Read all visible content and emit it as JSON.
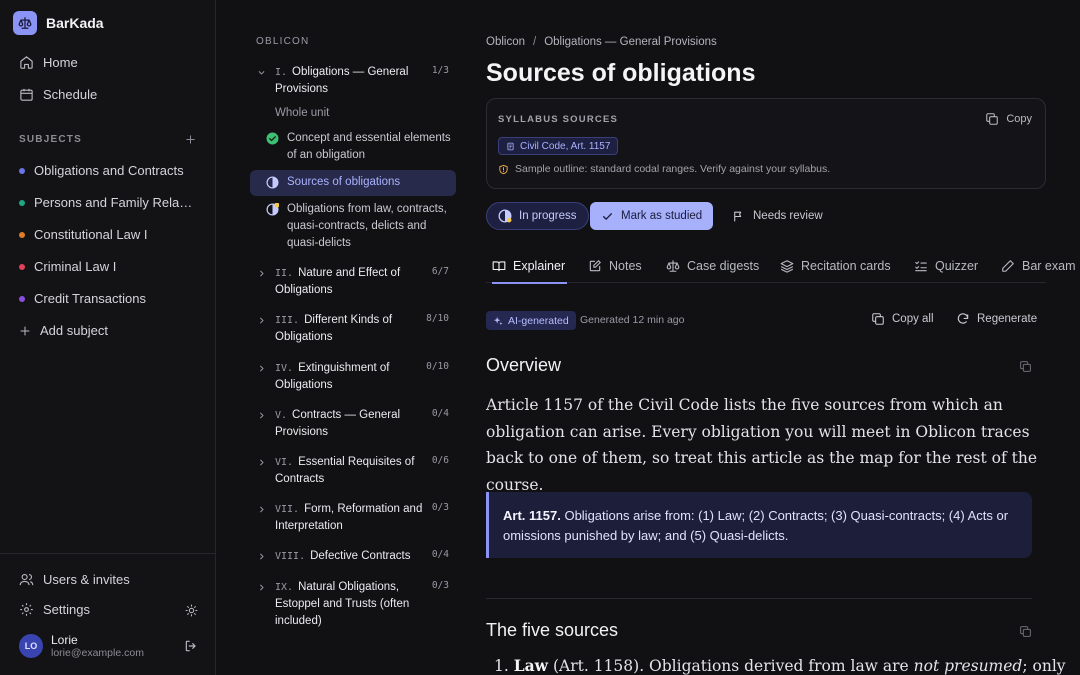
{
  "app": {
    "name": "BarKada"
  },
  "nav": {
    "home": "Home",
    "schedule": "Schedule"
  },
  "subjects": {
    "label": "SUBJECTS",
    "items": [
      {
        "name": "Obligations and Contracts",
        "color": "#6b74e6"
      },
      {
        "name": "Persons and Family Rela…",
        "color": "#1fa886"
      },
      {
        "name": "Constitutional Law I",
        "color": "#e07b2a"
      },
      {
        "name": "Criminal Law I",
        "color": "#e0405a"
      },
      {
        "name": "Credit Transactions",
        "color": "#8a4fe0"
      }
    ],
    "add": "Add subject"
  },
  "footer": {
    "users": "Users & invites",
    "settings": "Settings",
    "user": {
      "initials": "LO",
      "name": "Lorie",
      "email": "lorie@example.com"
    }
  },
  "outline": {
    "title": "OBLICON",
    "units": [
      {
        "num": "I.",
        "title": "Obligations — General Provisions",
        "count": "1/3",
        "expanded": true
      },
      {
        "num": "II.",
        "title": "Nature and Effect of Obligations",
        "count": "6/7"
      },
      {
        "num": "III.",
        "title": "Different Kinds of Obligations",
        "count": "8/10"
      },
      {
        "num": "IV.",
        "title": "Extinguishment of Obligations",
        "count": "0/10"
      },
      {
        "num": "V.",
        "title": "Contracts — General Provisions",
        "count": "0/4"
      },
      {
        "num": "VI.",
        "title": "Essential Requisites of Contracts",
        "count": "0/6"
      },
      {
        "num": "VII.",
        "title": "Form, Reformation and Interpretation",
        "count": "0/3"
      },
      {
        "num": "VIII.",
        "title": "Defective Contracts",
        "count": "0/4"
      },
      {
        "num": "IX.",
        "title": "Natural Obligations, Estoppel and Trusts (often included)",
        "count": "0/3"
      }
    ],
    "subs": [
      {
        "label": "Whole unit"
      },
      {
        "label": "Concept and essential elements of an obligation",
        "status": "done"
      },
      {
        "label": "Sources of obligations",
        "status": "in-progress",
        "active": true
      },
      {
        "label": "Obligations from law, contracts, quasi-contracts, delicts and quasi-delicts",
        "status": "flagged"
      }
    ]
  },
  "main": {
    "breadcrumb": [
      "Oblicon",
      "Obligations — General Provisions"
    ],
    "title": "Sources of obligations",
    "syllabus": {
      "label": "SYLLABUS SOURCES",
      "copy": "Copy",
      "chip": "Civil Code, Art. 1157",
      "note": "Sample outline: standard codal ranges. Verify against your syllabus."
    },
    "status": {
      "in_progress": "In progress",
      "mark_studied": "Mark as studied",
      "needs_review": "Needs review"
    },
    "tabs": [
      "Explainer",
      "Notes",
      "Case digests",
      "Recitation cards",
      "Quizzer",
      "Bar exam"
    ],
    "ai": {
      "badge": "AI-generated",
      "generated": "Generated 12 min ago",
      "copy_all": "Copy all",
      "regenerate": "Regenerate"
    },
    "overview": {
      "heading": "Overview",
      "text": "Article 1157 of the Civil Code lists the five sources from which an obligation can arise. Every obligation you will meet in Oblicon traces back to one of them, so treat this article as the map for the rest of the course."
    },
    "quote": {
      "ref": "Art. 1157.",
      "text": "Obligations arise from: (1) Law; (2) Contracts; (3) Quasi-contracts; (4) Acts or omissions punished by law; and (5) Quasi-delicts."
    },
    "five_sources": {
      "heading": "The five sources",
      "first": {
        "num": "1.",
        "term": "Law",
        "ref": "(Art. 1158). Obligations derived from law are",
        "emph": "not presumed",
        "rest": "; only"
      }
    }
  }
}
